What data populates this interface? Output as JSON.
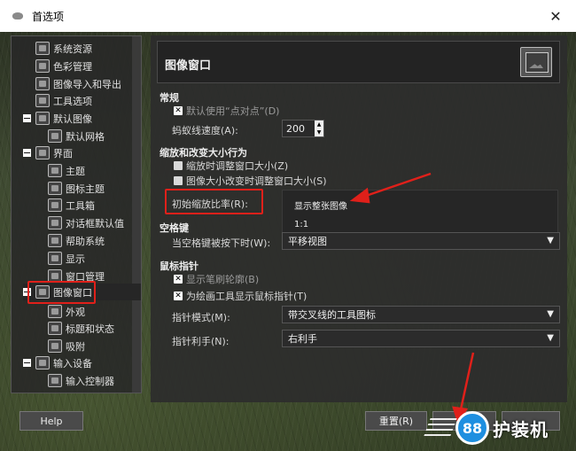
{
  "window": {
    "title": "首选项",
    "close_glyph": "✕"
  },
  "tree": [
    {
      "label": "系统资源",
      "indent": 1
    },
    {
      "label": "色彩管理",
      "indent": 1
    },
    {
      "label": "图像导入和导出",
      "indent": 1
    },
    {
      "label": "工具选项",
      "indent": 1
    },
    {
      "label": "默认图像",
      "indent": 0,
      "expanded": true
    },
    {
      "label": "默认网格",
      "indent": 2
    },
    {
      "label": "界面",
      "indent": 0,
      "expanded": true
    },
    {
      "label": "主题",
      "indent": 2
    },
    {
      "label": "图标主题",
      "indent": 2
    },
    {
      "label": "工具箱",
      "indent": 2
    },
    {
      "label": "对话框默认值",
      "indent": 2
    },
    {
      "label": "帮助系统",
      "indent": 2
    },
    {
      "label": "显示",
      "indent": 2
    },
    {
      "label": "窗口管理",
      "indent": 2
    },
    {
      "label": "图像窗口",
      "indent": 0,
      "expanded": true,
      "selected": true
    },
    {
      "label": "外观",
      "indent": 2
    },
    {
      "label": "标题和状态",
      "indent": 2
    },
    {
      "label": "吸附",
      "indent": 2
    },
    {
      "label": "输入设备",
      "indent": 0,
      "expanded": true
    },
    {
      "label": "输入控制器",
      "indent": 2
    }
  ],
  "header": {
    "title": "图像窗口",
    "icon": "image-window-icon"
  },
  "general": {
    "heading": "常规",
    "dot_for_dot": "默认使用“点对点”(D)",
    "dot_for_dot_checked": true,
    "marching_ants_label": "蚂蚁线速度(A):",
    "marching_ants_value": "200"
  },
  "zoom": {
    "heading": "缩放和改变大小行为",
    "resize_on_zoom": "缩放时调整窗口大小(Z)",
    "resize_on_image_change": "图像大小改变时调整窗口大小(S)",
    "initial_ratio_label": "初始缩放比率(R):",
    "options": [
      "显示整张图像",
      "1:1"
    ]
  },
  "space": {
    "heading": "空格键",
    "label": "当空格键被按下时(W):",
    "value": "平移视图"
  },
  "pointer": {
    "heading": "鼠标指针",
    "show_brush_outline": "显示笔刷轮廓(B)",
    "show_paint_pointer": "为绘画工具显示鼠标指针(T)",
    "mode_label": "指针模式(M):",
    "mode_value": "带交叉线的工具图标",
    "hand_label": "指针利手(N):",
    "hand_value": "右利手"
  },
  "buttons": {
    "help": "Help",
    "reset": "重置(R)"
  },
  "watermark": {
    "badge": "88",
    "text": "护装机"
  },
  "colors": {
    "highlight": "#e0201a",
    "watermark": "#1e8fe0"
  }
}
